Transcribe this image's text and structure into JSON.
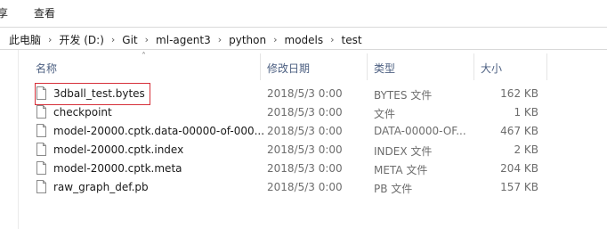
{
  "ribbon": {
    "tabs": [
      "享",
      "查看"
    ]
  },
  "address": {
    "crumbs": [
      "此电脑",
      "开发 (D:)",
      "Git",
      "ml-agent3",
      "python",
      "models",
      "test"
    ]
  },
  "columns": {
    "name": "名称",
    "date": "修改日期",
    "type": "类型",
    "size": "大小"
  },
  "files": [
    {
      "name": "3dball_test.bytes",
      "date": "2018/5/3 0:00",
      "type": "BYTES 文件",
      "size": "162 KB"
    },
    {
      "name": "checkpoint",
      "date": "2018/5/3 0:00",
      "type": "文件",
      "size": "1 KB"
    },
    {
      "name": "model-20000.cptk.data-00000-of-000...",
      "date": "2018/5/3 0:00",
      "type": "DATA-00000-OF...",
      "size": "467 KB"
    },
    {
      "name": "model-20000.cptk.index",
      "date": "2018/5/3 0:00",
      "type": "INDEX 文件",
      "size": "2 KB"
    },
    {
      "name": "model-20000.cptk.meta",
      "date": "2018/5/3 0:00",
      "type": "META 文件",
      "size": "204 KB"
    },
    {
      "name": "raw_graph_def.pb",
      "date": "2018/5/3 0:00",
      "type": "PB 文件",
      "size": "157 KB"
    }
  ],
  "annotation": {
    "color": "#d6303a",
    "highlighted_file": "3dball_test.bytes"
  },
  "icons": {
    "file": "file-icon",
    "separator": "chevron-right-icon",
    "sort": "sort-ascending-icon"
  }
}
